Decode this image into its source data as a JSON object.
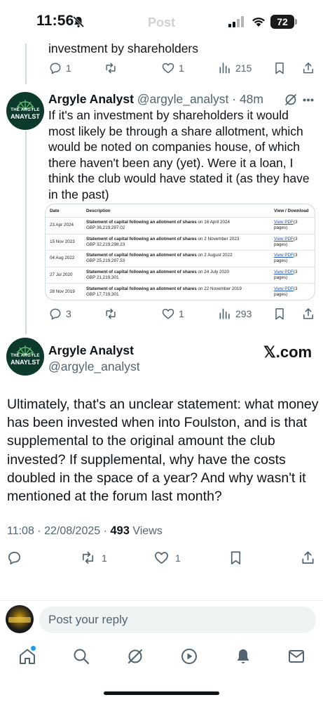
{
  "status_bar": {
    "time": "11:56",
    "battery": "72"
  },
  "header": {
    "title": "Post"
  },
  "parent_tail": {
    "text": "investment by shareholders",
    "replies": "1",
    "likes": "1",
    "views": "215"
  },
  "reply_tweet": {
    "avatar_line1": "THE ARGYLE",
    "avatar_line2": "ANAYLST",
    "name": "Argyle Analyst",
    "handle_time": "@argyle_analyst · 48m",
    "text": "If it's an investment by shareholders it would most likely be through a share allotment, which would be noted on companies house, of which there haven't been any (yet). Were it a loan, I think the club would have stated it (as they have in the past)",
    "table": {
      "headers": [
        "Date",
        "Description",
        "View / Download"
      ],
      "link_label": "View PDF",
      "rows": [
        {
          "date": "23 Apr 2024",
          "title": "Statement of capital following an allotment of shares",
          "on": " on 16 April 2024",
          "amount": "GBP 36,219,297.02",
          "pages": "(3 pages)"
        },
        {
          "date": "15 Nov 2023",
          "title": "Statement of capital following an allotment of shares",
          "on": " on 2 November 2023",
          "amount": "GBP 32,219,298.23",
          "pages": "(3 pages)"
        },
        {
          "date": "04 Aug 2022",
          "title": "Statement of capital following an allotment of shares",
          "on": " on 2 August 2022",
          "amount": "GBP 25,219,297.53",
          "pages": "(3 pages)"
        },
        {
          "date": "27 Jul 2020",
          "title": "Statement of capital following an allotment of shares",
          "on": " on 24 July 2020",
          "amount": "GBP 21,219,301",
          "pages": "(3 pages)"
        },
        {
          "date": "28 Nov 2019",
          "title": "Statement of capital following an allotment of shares",
          "on": " on 22 November 2019",
          "amount": "GBP 17,719,301",
          "pages": "(3 pages)"
        }
      ]
    },
    "replies": "3",
    "likes": "1",
    "views": "293"
  },
  "main_tweet": {
    "avatar_line1": "THE ARGYLE",
    "avatar_line2": "ANAYLST",
    "name": "Argyle Analyst",
    "handle": "@argyle_analyst",
    "source_badge": "𝕏.com",
    "text": "Ultimately, that's an unclear statement: what money has been invested when into Foulston, and is that supplemental to the original amount the club invested? If supplemental, why have the costs doubled in the space of a year? And why wasn't it mentioned at the forum last month?",
    "timestamp": "11:08 · 22/08/2025 · ",
    "views_count": "493",
    "views_label": " Views",
    "reposts": "1",
    "likes": "1"
  },
  "composer": {
    "placeholder": "Post your reply"
  },
  "colors": {
    "accent": "#1d9bf0",
    "text": "#0f1419",
    "muted": "#536471",
    "avatar_bg": "#0c3b2e"
  },
  "nav": [
    "home-icon",
    "search-icon",
    "grok-icon",
    "video-icon",
    "notifications-icon",
    "messages-icon"
  ]
}
